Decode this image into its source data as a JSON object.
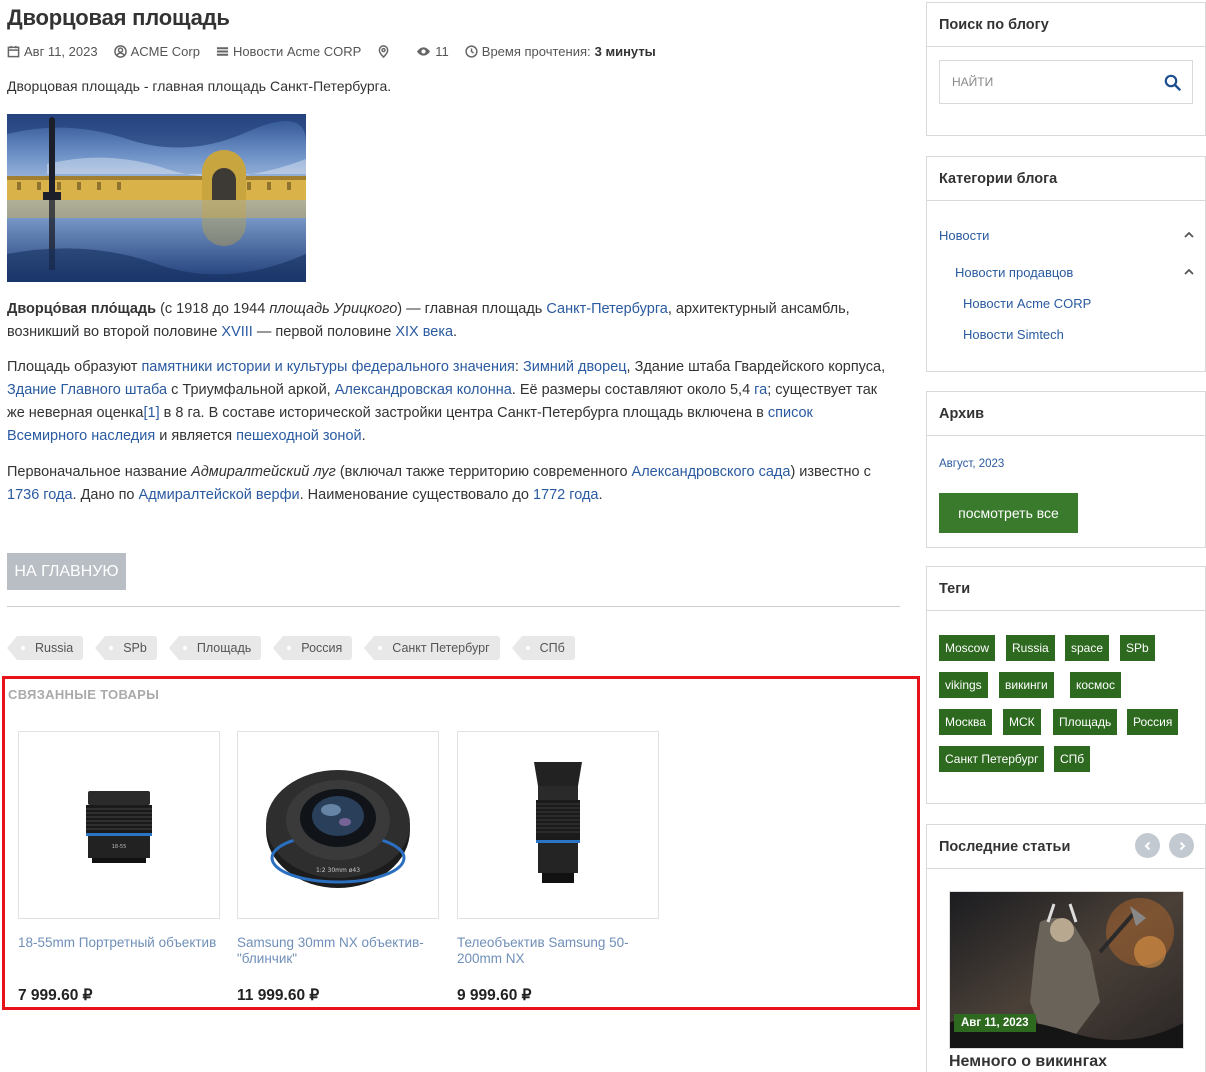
{
  "post": {
    "title": "Дворцовая площадь",
    "meta": {
      "date": "Авг 11, 2023",
      "author": "ACME Corp",
      "category": "Новости Acme CORP",
      "views": "11",
      "read_label": "Время прочтения:",
      "read_value": "3 минуты"
    },
    "intro": "Дворцовая площадь - главная площадь Санкт-Петербурга.",
    "p1": {
      "b1": "Дворцо́вая пло́щадь",
      "t1": " (с 1918 до 1944 ",
      "i1": "площадь Урицкого",
      "t2": ") — главная площадь ",
      "l1": "Санкт-Петербурга",
      "t3": ", архитектурный ансамбль, возникший во второй половине ",
      "l2": "XVIII",
      "t4": " — первой половине ",
      "l3": "XIX века",
      "t5": "."
    },
    "p2": {
      "t1": "Площадь образуют ",
      "l1": "памятники истории и культуры федерального значения",
      "t2": ": ",
      "l2": "Зимний дворец",
      "t3": ", Здание штаба Гвардейского корпуса, ",
      "l3": "Здание Главного штаба",
      "t4": " с Триумфальной аркой, ",
      "l4": "Александровская колонна",
      "t5": ". Её размеры составляют около 5,4 ",
      "l5": "га",
      "t6": "; существует так же неверная оценка",
      "l6": "[1]",
      "t7": " в 8 га. В составе исторической застройки центра Санкт-Петербурга площадь включена в ",
      "l7": "список Всемирного наследия",
      "t8": " и является ",
      "l8": "пешеходной зоной",
      "t9": "."
    },
    "p3": {
      "t1": "Первоначальное название ",
      "i1": "Адмиралтейский луг",
      "t2": " (включал также территорию современного ",
      "l1": "Александровского сада",
      "t3": ") известно с ",
      "l2": "1736 года",
      "t4": ". Дано по ",
      "l3": "Адмиралтейской верфи",
      "t5": ". Наименование существовало до ",
      "l4": "1772 года",
      "t6": "."
    },
    "home_button": "НА ГЛАВНУЮ",
    "tags": [
      "Russia",
      "SPb",
      "Площадь",
      "Россия",
      "Санкт Петербург",
      "СПб"
    ]
  },
  "related": {
    "title": "СВЯЗАННЫЕ ТОВАРЫ",
    "products": [
      {
        "name": "18-55mm Портретный объектив",
        "price": "7 999.60 ₽"
      },
      {
        "name": "Samsung 30mm NX объектив-\"блинчик\"",
        "price": "11 999.60 ₽"
      },
      {
        "name": "Телеобъектив Samsung 50-200mm NX",
        "price": "9 999.60 ₽"
      }
    ]
  },
  "sidebar": {
    "search": {
      "title": "Поиск по блогу",
      "placeholder": "НАЙТИ"
    },
    "categories": {
      "title": "Категории блога",
      "items": [
        "Новости",
        "Новости продавцов",
        "Новости Acme CORP",
        "Новости Simtech"
      ]
    },
    "archive": {
      "title": "Архив",
      "month": "Август, 2023",
      "button": "посмотреть все"
    },
    "tags": {
      "title": "Теги",
      "items": [
        "Moscow",
        "Russia",
        "space",
        "SPb",
        "vikings",
        "викинги",
        "космос",
        "Москва",
        "МСК",
        "Площадь",
        "Россия",
        "Санкт Петербург",
        "СПб"
      ]
    },
    "latest": {
      "title": "Последние статьи",
      "date": "Авг 11, 2023",
      "article_title": "Немного о викингах"
    }
  },
  "colors": {
    "link": "#2a5aa0",
    "green": "#2d6a1f",
    "highlight_border": "#e8121b",
    "button_gray": "#b8bec4"
  }
}
